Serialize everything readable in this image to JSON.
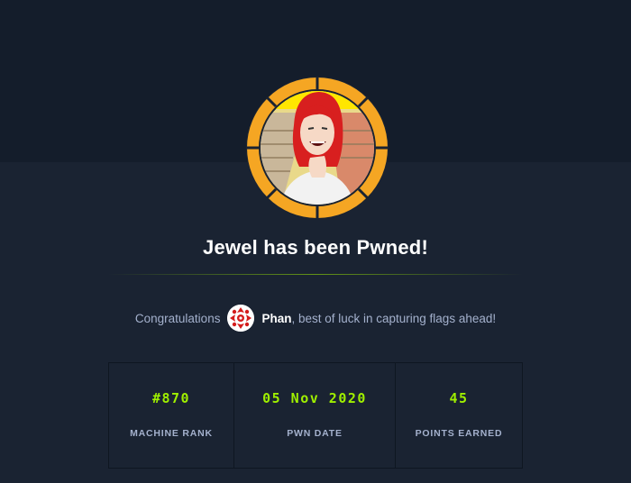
{
  "colors": {
    "background": "#1a2332",
    "top_band": "#141d2b",
    "accent_green": "#9fef00",
    "muted_text": "#a4b1cd",
    "badge_orange": "#f5a623"
  },
  "badge": {
    "icon": "machine-avatar-icon"
  },
  "title": "Jewel has been Pwned!",
  "congrats": {
    "prefix": "Congratulations",
    "avatar_icon": "user-avatar-icon",
    "username": "Phan",
    "suffix": ", best of luck in capturing flags ahead!"
  },
  "stats": [
    {
      "value": "#870",
      "label": "MACHINE RANK"
    },
    {
      "value": "05 Nov 2020",
      "label": "PWN DATE"
    },
    {
      "value": "45",
      "label": "POINTS EARNED"
    }
  ]
}
